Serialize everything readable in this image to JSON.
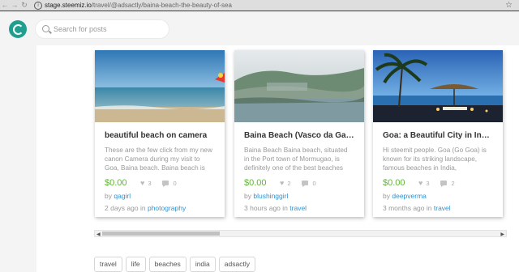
{
  "browser": {
    "url_host": "stage.steemiz.io",
    "url_path": "/travel/@adsactly/baina-beach-the-beauty-of-sea"
  },
  "search": {
    "placeholder": "Search for posts"
  },
  "cards": [
    {
      "title": "beautiful beach on camera",
      "excerpt": "These are the few click from my new canon Camera during my visit to Goa, Baina beach. Baina beach is",
      "payout": "$0.00",
      "votes": "3",
      "comments": "0",
      "by_prefix": "by",
      "author": "qagirl",
      "time": "2 days ago",
      "in_label": "in",
      "category": "photography"
    },
    {
      "title": "Baina Beach (Vasco da Gama)",
      "excerpt": "Baina Beach Baina beach, situated in the Port town of Mormugao, is definitely one of the best beaches",
      "payout": "$0.00",
      "votes": "2",
      "comments": "0",
      "by_prefix": "by",
      "author": "blushinggirl",
      "time": "3 hours ago",
      "in_label": "in",
      "category": "travel"
    },
    {
      "title": "Goa: a Beautiful City in India.",
      "excerpt": "Hi steemit people. Goa (Go Goa) is known for its striking landscape, famous beaches in India,",
      "payout": "$0.00",
      "votes": "3",
      "comments": "2",
      "by_prefix": "by",
      "author": "deepverma",
      "time": "3 months ago",
      "in_label": "in",
      "category": "travel"
    }
  ],
  "tags": [
    "travel",
    "life",
    "beaches",
    "india",
    "adsactly"
  ]
}
